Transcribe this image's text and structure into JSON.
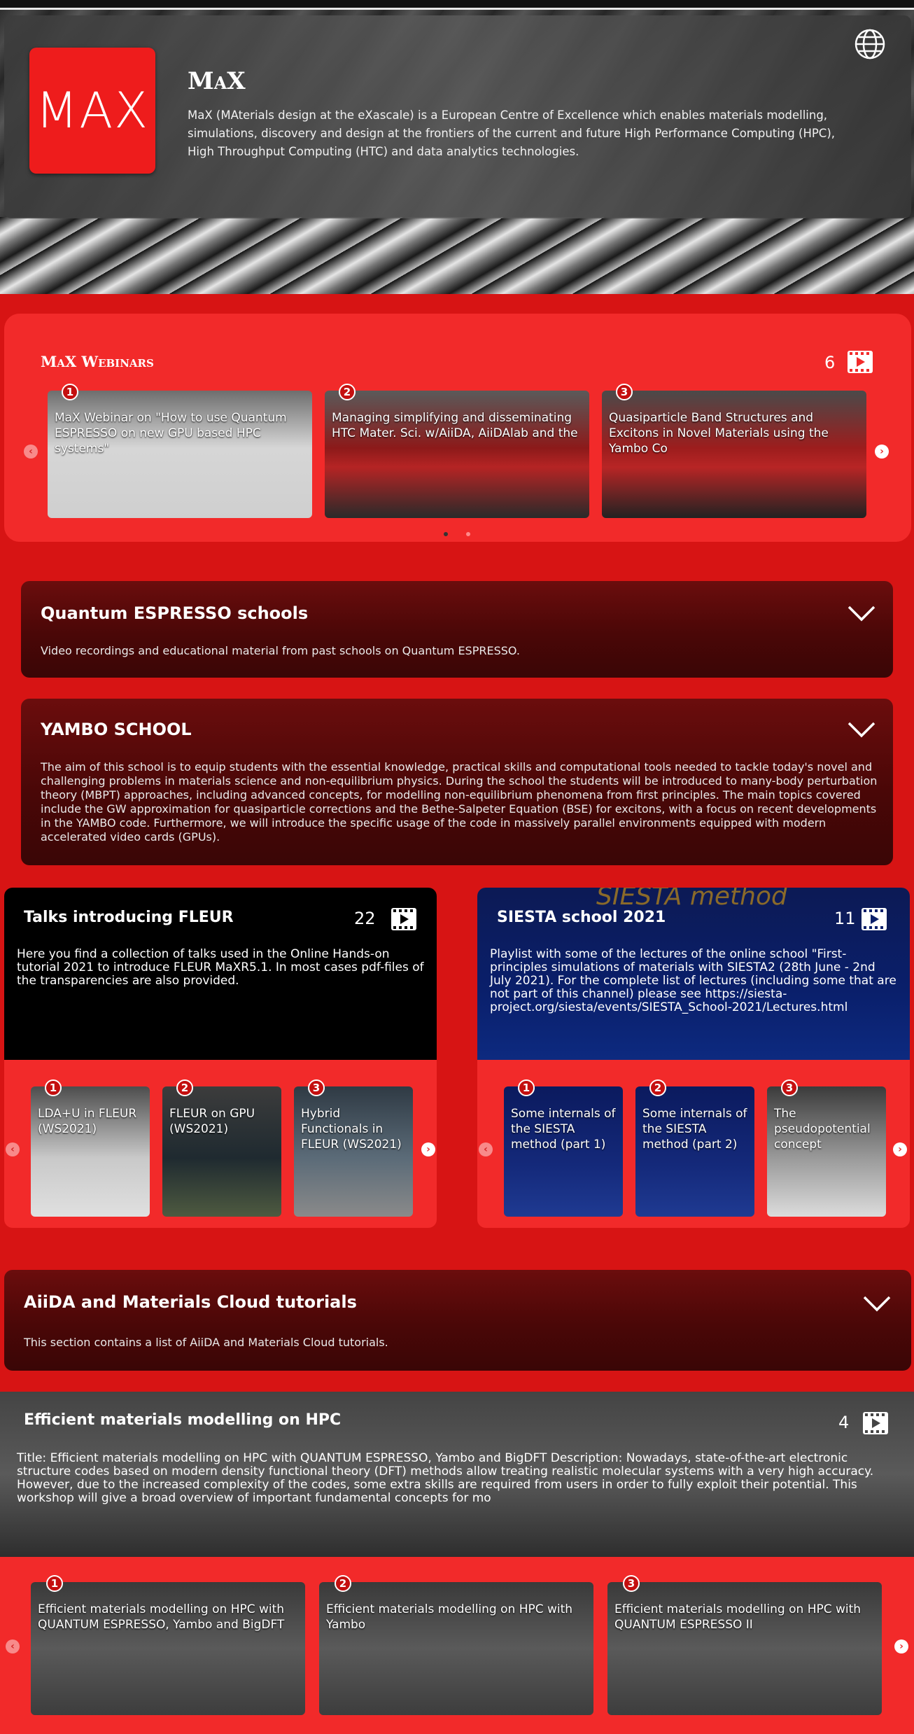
{
  "channel": {
    "title": "MaX",
    "logo_text": "MAX",
    "description": "MaX (MAterials design at the eXascale) is a European Centre of Excellence which enables materials modelling, simulations, discovery and design at the frontiers of the current and future High Performance Computing (HPC), High Throughput Computing (HTC) and data analytics technologies."
  },
  "icons": {
    "language": "globe-icon",
    "playlist": "video-playlist-icon",
    "expand": "chevron-down-icon"
  },
  "colors": {
    "accent": "#f22a2a",
    "background_red": "#d71414",
    "dark_red": "#4a0707"
  },
  "webinars": {
    "title": "MaX Webinars",
    "count": "6",
    "videos": [
      {
        "index": "1",
        "title": "MaX Webinar on \"How to use Quantum ESPRESSO on new GPU based HPC systems\""
      },
      {
        "index": "2",
        "title": "Managing simplifying and disseminating HTC Mater. Sci. w/AiiDA, AiiDAlab and the"
      },
      {
        "index": "3",
        "title": "Quasiparticle Band Structures and Excitons in Novel Materials using the Yambo Co"
      }
    ]
  },
  "qe_schools": {
    "title": "Quantum ESPRESSO schools",
    "description": "Video recordings and educational material from past schools on Quantum ESPRESSO."
  },
  "yambo_school": {
    "title": "YAMBO SCHOOL",
    "description": "The aim of this school is to equip students with the essential knowledge, practical skills and computational tools needed to tackle today's novel and challenging problems in materials science and non-equilibrium physics. During the school the students will be introduced to many-body perturbation theory (MBPT) approaches, including advanced concepts, for modelling non-equilibrium phenomena from first principles. The main topics covered include the GW approximation for quasiparticle corrections and the Bethe-Salpeter Equation (BSE) for excitons, with a focus on recent developments in the YAMBO code. Furthermore, we will introduce the specific usage of the code in massively parallel environments equipped with modern accelerated video cards (GPUs)."
  },
  "fleur": {
    "title": "Talks introducing FLEUR",
    "count": "22",
    "description": "Here you find a collection of talks used in the Online Hands-on tutorial 2021 to introduce FLEUR MaXR5.1. In most cases pdf-files of the transparencies are also provided.",
    "videos": [
      {
        "index": "1",
        "title": "LDA+U in FLEUR (WS2021)"
      },
      {
        "index": "2",
        "title": "FLEUR on GPU (WS2021)"
      },
      {
        "index": "3",
        "title": "Hybrid Functionals in FLEUR (WS2021)"
      }
    ]
  },
  "siesta": {
    "title": "SIESTA school 2021",
    "count": "11",
    "banner_text": "SIESTA method",
    "description": "Playlist with some of the lectures of the online school \"First-principles simulations of materials with SIESTA2 (28th June - 2nd July 2021). For the complete list of lectures (including some that are not part of this channel) please see https://siesta-project.org/siesta/events/SIESTA_School-2021/Lectures.html",
    "videos": [
      {
        "index": "1",
        "title": "Some internals of the SIESTA method (part 1)"
      },
      {
        "index": "2",
        "title": "Some internals of the SIESTA method (part 2)"
      },
      {
        "index": "3",
        "title": "The pseudopotential concept"
      }
    ]
  },
  "aiida": {
    "title": "AiiDA and Materials Cloud tutorials",
    "description": "This section contains a list of AiiDA and Materials Cloud tutorials."
  },
  "hpc": {
    "title": "Efficient materials modelling on HPC",
    "count": "4",
    "description": "Title: Efficient materials modelling on HPC with QUANTUM ESPRESSO, Yambo and BigDFT Description: Nowadays, state-of-the-art electronic structure codes based on modern density functional theory (DFT) methods allow treating realistic molecular systems with a very high accuracy. However, due to the increased complexity of the codes, some extra skills are required from users in order to fully exploit their potential. This workshop will give a broad overview of important fundamental concepts for mo",
    "videos": [
      {
        "index": "1",
        "title": "Efficient materials modelling on HPC with QUANTUM ESPRESSO, Yambo and BigDFT"
      },
      {
        "index": "2",
        "title": "Efficient materials modelling on HPC with Yambo"
      },
      {
        "index": "3",
        "title": "Efficient materials modelling on HPC with QUANTUM ESPRESSO II"
      }
    ]
  }
}
